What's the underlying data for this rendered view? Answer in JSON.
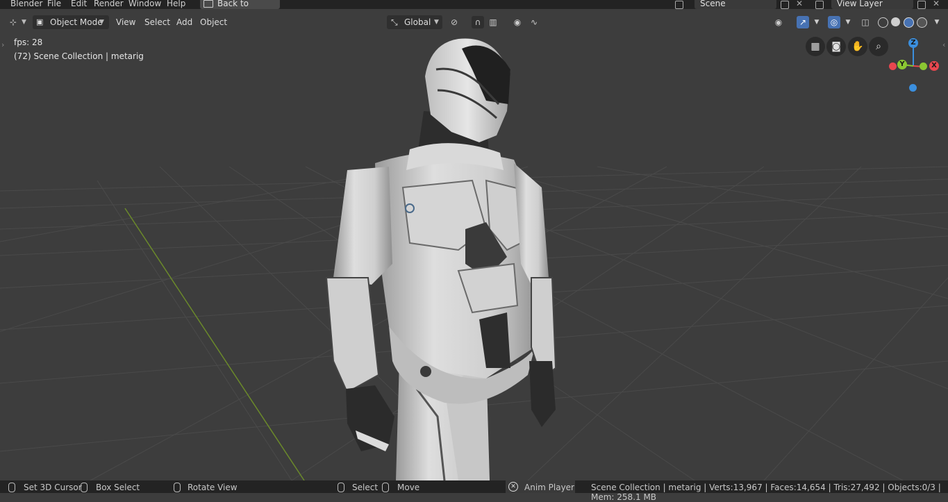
{
  "topbar": {
    "menu": [
      "Blender",
      "File",
      "Edit",
      "Render",
      "Window",
      "Help"
    ],
    "back_button": "Back to Previous",
    "scene_name": "Scene",
    "view_layer_name": "View Layer"
  },
  "viewport_header": {
    "mode": "Object Mode",
    "menus": [
      "View",
      "Select",
      "Add",
      "Object"
    ],
    "orientation": "Global"
  },
  "overlay": {
    "fps": "fps: 28",
    "collection": "(72) Scene Collection | metarig"
  },
  "gizmo": {
    "z": "Z",
    "y": "Y",
    "x": "X",
    "colors": {
      "x": "#e8474f",
      "y": "#8bc632",
      "z": "#3b8fde"
    }
  },
  "statusbar": {
    "set_cursor": "Set 3D Cursor",
    "box_select": "Box Select",
    "rotate_view": "Rotate View",
    "select": "Select",
    "move": "Move",
    "anim_player": "Anim Player",
    "stats": "Scene Collection | metarig | Verts:13,967 | Faces:14,654 | Tris:27,492 | Objects:0/3 | Mem: 258.1 MB"
  }
}
